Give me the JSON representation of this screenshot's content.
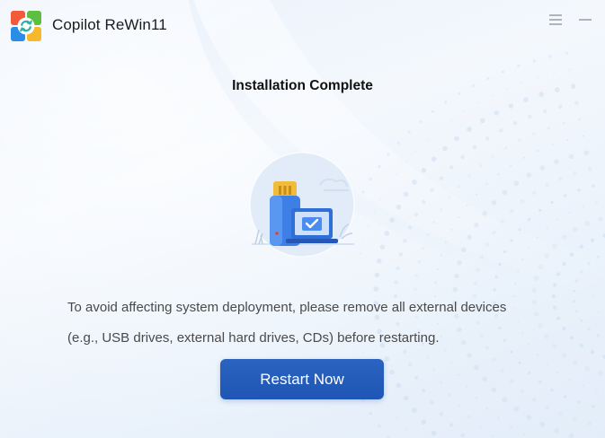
{
  "app": {
    "title": "Copilot ReWin11",
    "logo_icon": "copilot-rewin-logo-icon"
  },
  "window_controls": {
    "menu_icon": "hamburger-menu-icon",
    "minimize_icon": "minimize-icon"
  },
  "main": {
    "heading": "Installation Complete",
    "illustration_icon": "usb-drive-laptop-check-icon",
    "message_line1": "To avoid affecting system deployment, please remove all external devices",
    "message_line2": "(e.g., USB drives, external hard drives, CDs) before restarting.",
    "restart_button_label": "Restart Now"
  },
  "colors": {
    "accent": "#1f56b5",
    "background": "#eef4fc",
    "heading_text": "#111111",
    "body_text": "#4a4a4a"
  }
}
